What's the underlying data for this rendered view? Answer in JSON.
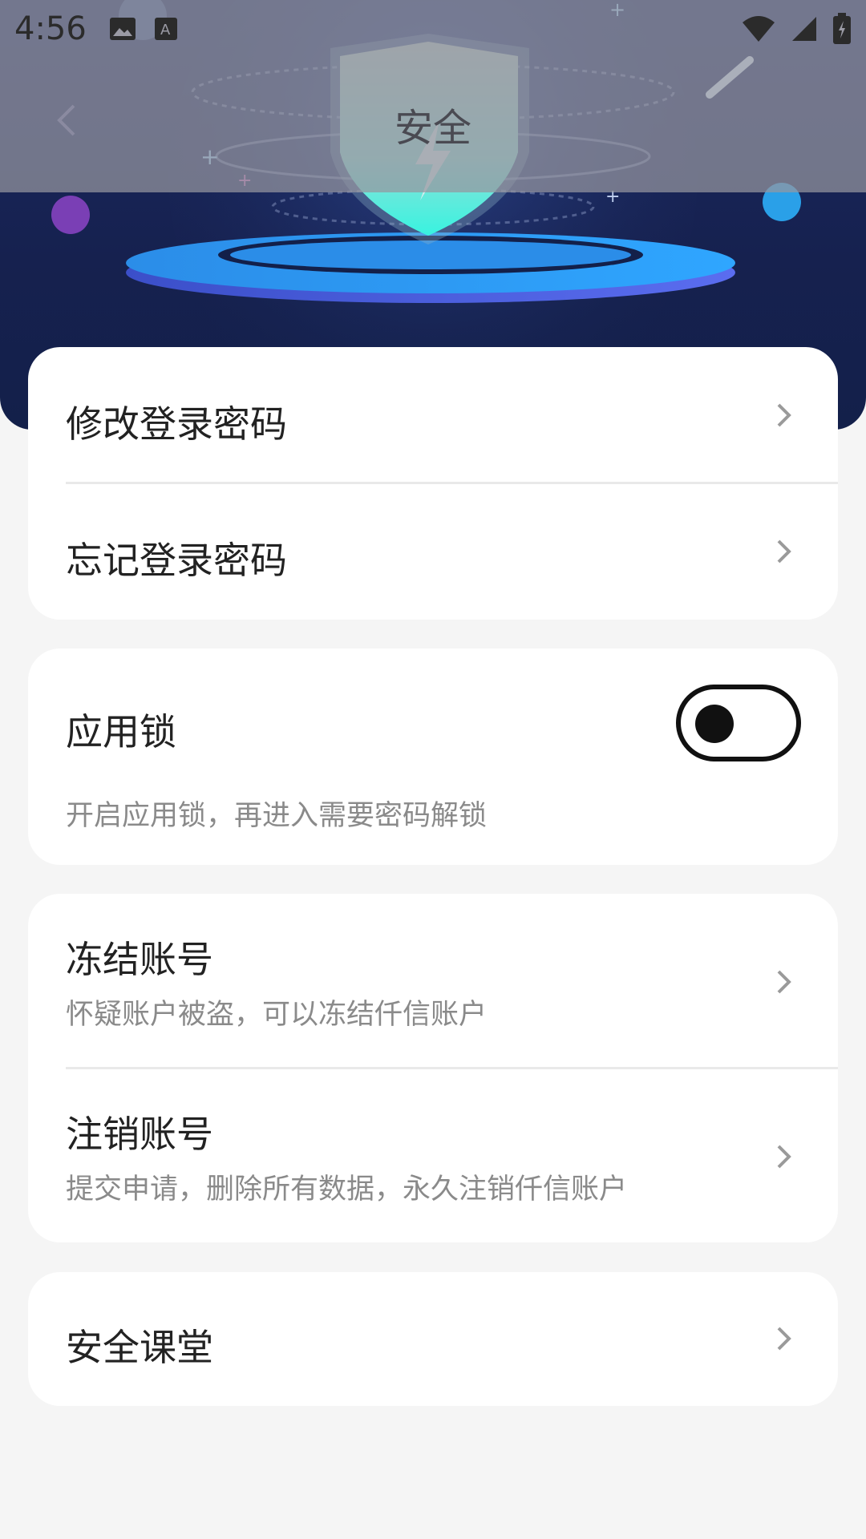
{
  "status_bar": {
    "time": "4:56",
    "icons": [
      "image-icon",
      "text-a-icon",
      "wifi-icon",
      "cell-signal-icon",
      "battery-icon"
    ]
  },
  "header": {
    "title": "安全"
  },
  "colors": {
    "hero_bg": "#1b2a63",
    "card_bg": "#ffffff",
    "page_bg": "#f5f5f5",
    "toggle": "#111111",
    "shield": "#3ff0e0"
  },
  "password_card": {
    "items": [
      {
        "label": "修改登录密码"
      },
      {
        "label": "忘记登录密码"
      }
    ]
  },
  "app_lock_card": {
    "label": "应用锁",
    "description": "开启应用锁，再进入需要密码解锁",
    "enabled": false
  },
  "account_card": {
    "items": [
      {
        "label": "冻结账号",
        "sub": "怀疑账户被盗，可以冻结仟信账户"
      },
      {
        "label": "注销账号",
        "sub": "提交申请，删除所有数据，永久注销仟信账户"
      }
    ]
  },
  "classroom_card": {
    "label": "安全课堂"
  }
}
